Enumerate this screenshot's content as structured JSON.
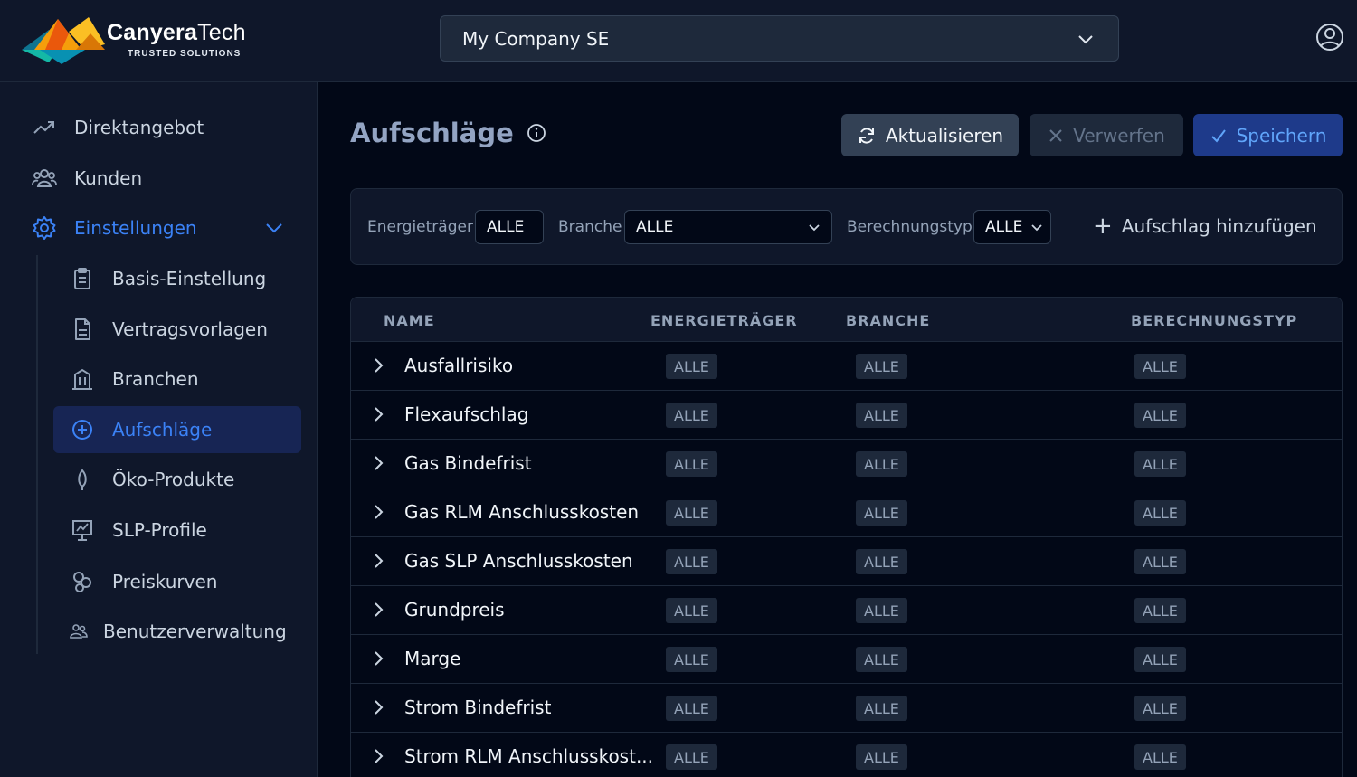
{
  "brand": {
    "name_bold": "Canyera",
    "name_light": "Tech",
    "tagline": "TRUSTED SOLUTIONS"
  },
  "header": {
    "company": "My Company SE"
  },
  "sidebar": {
    "items": [
      {
        "label": "Direktangebot",
        "icon": "trending-up-icon"
      },
      {
        "label": "Kunden",
        "icon": "users-icon"
      },
      {
        "label": "Einstellungen",
        "icon": "gear-icon"
      }
    ],
    "sub_items": [
      {
        "label": "Basis-Einstellung",
        "icon": "clipboard-icon"
      },
      {
        "label": "Vertragsvorlagen",
        "icon": "document-icon"
      },
      {
        "label": "Branchen",
        "icon": "building-icon"
      },
      {
        "label": "Aufschläge",
        "icon": "plus-circle-icon"
      },
      {
        "label": "Öko-Produkte",
        "icon": "leaf-icon"
      },
      {
        "label": "SLP-Profile",
        "icon": "chart-board-icon"
      },
      {
        "label": "Preiskurven",
        "icon": "circles-icon"
      },
      {
        "label": "Benutzerverwaltung",
        "icon": "user-group-icon"
      }
    ]
  },
  "main": {
    "title": "Aufschläge",
    "buttons": {
      "refresh": "Aktualisieren",
      "discard": "Verwerfen",
      "save": "Speichern"
    },
    "filters": {
      "energietraeger_label": "Energieträger",
      "energietraeger_value": "ALLE",
      "branche_label": "Branche",
      "branche_value": "ALLE",
      "berechnungstyp_label": "Berechnungstyp",
      "berechnungstyp_value": "ALLE",
      "add_label": "Aufschlag hinzufügen"
    },
    "table": {
      "columns": [
        "NAME",
        "ENERGIETRÄGER",
        "BRANCHE",
        "BERECHNUNGSTYP"
      ],
      "rows": [
        {
          "name": "Ausfallrisiko",
          "energietraeger": "ALLE",
          "branche": "ALLE",
          "berechnungstyp": "ALLE"
        },
        {
          "name": "Flexaufschlag",
          "energietraeger": "ALLE",
          "branche": "ALLE",
          "berechnungstyp": "ALLE"
        },
        {
          "name": "Gas Bindefrist",
          "energietraeger": "ALLE",
          "branche": "ALLE",
          "berechnungstyp": "ALLE"
        },
        {
          "name": "Gas RLM Anschlusskosten",
          "energietraeger": "ALLE",
          "branche": "ALLE",
          "berechnungstyp": "ALLE"
        },
        {
          "name": "Gas SLP Anschlusskosten",
          "energietraeger": "ALLE",
          "branche": "ALLE",
          "berechnungstyp": "ALLE"
        },
        {
          "name": "Grundpreis",
          "energietraeger": "ALLE",
          "branche": "ALLE",
          "berechnungstyp": "ALLE"
        },
        {
          "name": "Marge",
          "energietraeger": "ALLE",
          "branche": "ALLE",
          "berechnungstyp": "ALLE"
        },
        {
          "name": "Strom Bindefrist",
          "energietraeger": "ALLE",
          "branche": "ALLE",
          "berechnungstyp": "ALLE"
        },
        {
          "name": "Strom RLM Anschlusskost...",
          "energietraeger": "ALLE",
          "branche": "ALLE",
          "berechnungstyp": "ALLE"
        }
      ]
    }
  },
  "colors": {
    "accent": "#3b82f6",
    "background": "#020817",
    "panel": "#0f172a",
    "border": "#1e293b"
  }
}
